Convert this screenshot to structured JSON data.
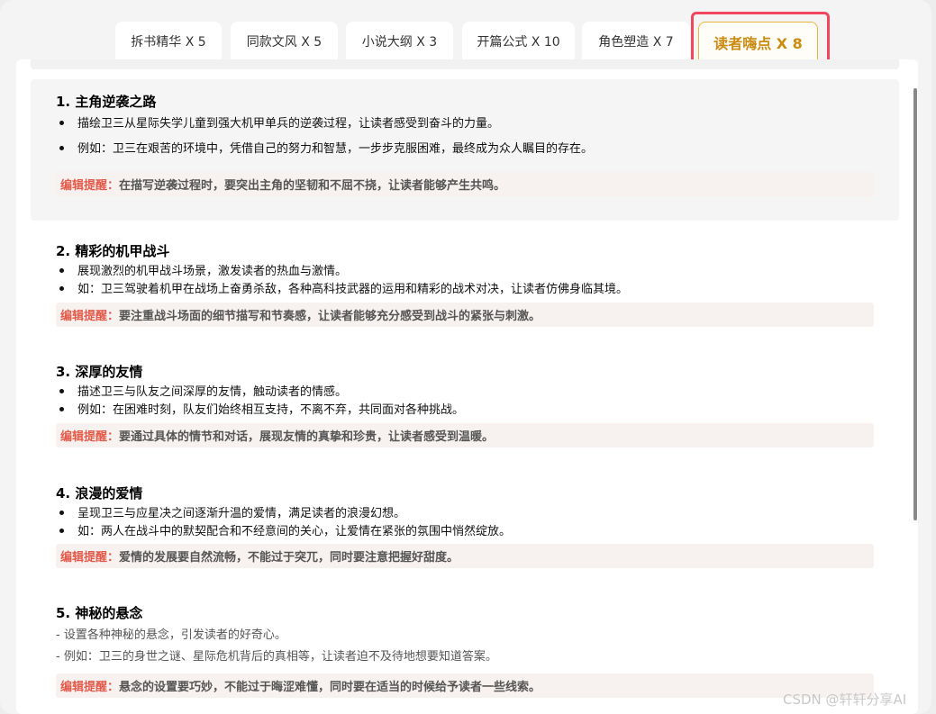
{
  "tabs": [
    {
      "label": "拆书精华 X 5"
    },
    {
      "label": "同款文风 X 5"
    },
    {
      "label": "小说大纲 X 3"
    },
    {
      "label": "开篇公式 X 10"
    },
    {
      "label": "角色塑造 X 7"
    },
    {
      "label": "读者嗨点 X 8",
      "active": true
    }
  ],
  "tip_label": "编辑提醒：",
  "sections": [
    {
      "title": "1. 主角逆袭之路",
      "bullets": [
        "描绘卫三从星际失学儿童到强大机甲单兵的逆袭过程，让读者感受到奋斗的力量。",
        "例如：卫三在艰苦的环境中，凭借自己的努力和智慧，一步步克服困难，最终成为众人瞩目的存在。"
      ],
      "tip": "在描写逆袭过程时，要突出主角的坚韧和不屈不挠，让读者能够产生共鸣。"
    },
    {
      "title": "2. 精彩的机甲战斗",
      "bullets": [
        "展现激烈的机甲战斗场景，激发读者的热血与激情。",
        "如：卫三驾驶着机甲在战场上奋勇杀敌，各种高科技武器的运用和精彩的战术对决，让读者仿佛身临其境。"
      ],
      "tip": "要注重战斗场面的细节描写和节奏感，让读者能够充分感受到战斗的紧张与刺激。"
    },
    {
      "title": "3. 深厚的友情",
      "bullets": [
        "描述卫三与队友之间深厚的友情，触动读者的情感。",
        "例如：在困难时刻，队友们始终相互支持，不离不弃，共同面对各种挑战。"
      ],
      "tip": "要通过具体的情节和对话，展现友情的真挚和珍贵，让读者感受到温暖。"
    },
    {
      "title": "4. 浪漫的爱情",
      "bullets": [
        "呈现卫三与应星决之间逐渐升温的爱情，满足读者的浪漫幻想。",
        "如：两人在战斗中的默契配合和不经意间的关心，让爱情在紧张的氛围中悄然绽放。"
      ],
      "tip": "爱情的发展要自然流畅，不能过于突兀，同时要注意把握好甜度。"
    },
    {
      "title": "5. 神秘的悬念",
      "lines": [
        "- 设置各种神秘的悬念，引发读者的好奇心。",
        "- 例如：卫三的身世之谜、星际危机背后的真相等，让读者迫不及待地想要知道答案。"
      ],
      "tip": "悬念的设置要巧妙，不能过于晦涩难懂，同时要在适当的时候给予读者一些线索。"
    }
  ],
  "watermark": "CSDN @轩轩分享AI"
}
